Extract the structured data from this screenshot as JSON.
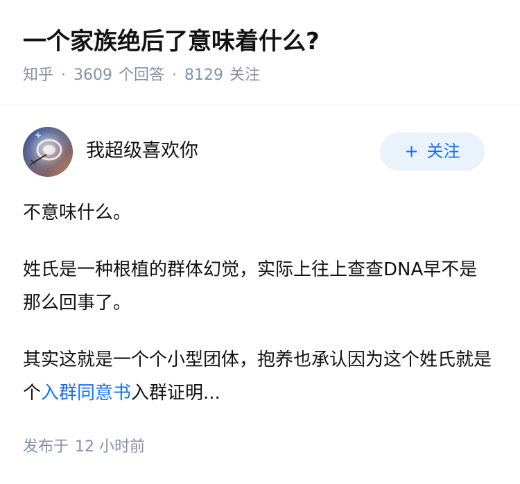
{
  "question": {
    "title": "一个家族绝后了意味着什么?",
    "source": "知乎",
    "separator": "·",
    "answer_count": "3609",
    "answer_label": "个回答",
    "follower_count": "8129",
    "follower_label": "关注"
  },
  "answer": {
    "author_name": "我超级喜欢你",
    "follow_button": {
      "icon": "+",
      "label": "关注"
    },
    "paragraphs": {
      "p1": "不意味什么。",
      "p2": "姓氏是一种根植的群体幻觉，实际上往上查查DNA早不是那么回事了。",
      "p3_before": "其实这就是一个个小型团体，抱养也承认因为这个姓氏就是个",
      "p3_link": "入群同意书",
      "p3_after": "入群证明..."
    },
    "publish_label": "发布于",
    "publish_time": "12 小时前"
  },
  "colors": {
    "text_primary": "#121212",
    "text_secondary": "#8590a6",
    "accent": "#1772f6",
    "follow_button_bg": "#eaf2fc",
    "divider": "#ebebeb"
  }
}
